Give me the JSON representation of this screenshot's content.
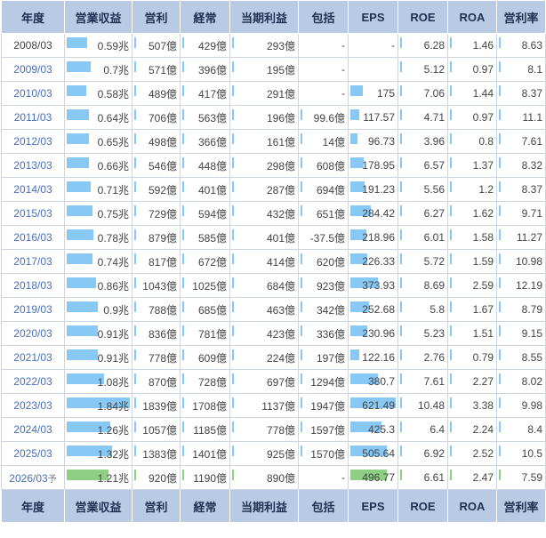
{
  "headers": [
    "年度",
    "営業収益",
    "営利",
    "経常",
    "当期利益",
    "包括",
    "EPS",
    "ROE",
    "ROA",
    "営利率"
  ],
  "estimate_mark": "予",
  "rows": [
    {
      "year": "2008/03",
      "revenue": "0.59兆",
      "rev_val": 0.59,
      "op": "507億",
      "ord": "429億",
      "net": "293億",
      "comp": "-",
      "comp_show": false,
      "eps": "-",
      "eps_val": 0,
      "roe": "6.28",
      "roa": "1.46",
      "margin": "8.63"
    },
    {
      "year": "2009/03",
      "revenue": "0.7兆",
      "rev_val": 0.7,
      "op": "571億",
      "ord": "396億",
      "net": "195億",
      "comp": "-",
      "comp_show": false,
      "eps": "",
      "eps_val": 0,
      "roe": "5.12",
      "roa": "0.97",
      "margin": "8.1"
    },
    {
      "year": "2010/03",
      "revenue": "0.58兆",
      "rev_val": 0.58,
      "op": "489億",
      "ord": "417億",
      "net": "291億",
      "comp": "-",
      "comp_show": false,
      "eps": "175",
      "eps_val": 175,
      "roe": "7.06",
      "roa": "1.44",
      "margin": "8.37"
    },
    {
      "year": "2011/03",
      "revenue": "0.64兆",
      "rev_val": 0.64,
      "op": "706億",
      "ord": "563億",
      "net": "196億",
      "comp": "99.6億",
      "comp_show": true,
      "eps": "117.57",
      "eps_val": 117.57,
      "roe": "4.71",
      "roa": "0.97",
      "margin": "11.1"
    },
    {
      "year": "2012/03",
      "revenue": "0.65兆",
      "rev_val": 0.65,
      "op": "498億",
      "ord": "366億",
      "net": "161億",
      "comp": "14億",
      "comp_show": true,
      "eps": "96.73",
      "eps_val": 96.73,
      "roe": "3.96",
      "roa": "0.8",
      "margin": "7.61"
    },
    {
      "year": "2013/03",
      "revenue": "0.66兆",
      "rev_val": 0.66,
      "op": "546億",
      "ord": "448億",
      "net": "298億",
      "comp": "608億",
      "comp_show": true,
      "eps": "178.95",
      "eps_val": 178.95,
      "roe": "6.57",
      "roa": "1.37",
      "margin": "8.32"
    },
    {
      "year": "2014/03",
      "revenue": "0.71兆",
      "rev_val": 0.71,
      "op": "592億",
      "ord": "401億",
      "net": "287億",
      "comp": "694億",
      "comp_show": true,
      "eps": "191.23",
      "eps_val": 191.23,
      "roe": "5.56",
      "roa": "1.2",
      "margin": "8.37"
    },
    {
      "year": "2015/03",
      "revenue": "0.75兆",
      "rev_val": 0.75,
      "op": "729億",
      "ord": "594億",
      "net": "432億",
      "comp": "651億",
      "comp_show": true,
      "eps": "284.42",
      "eps_val": 284.42,
      "roe": "6.27",
      "roa": "1.62",
      "margin": "9.71"
    },
    {
      "year": "2016/03",
      "revenue": "0.78兆",
      "rev_val": 0.78,
      "op": "879億",
      "ord": "585億",
      "net": "401億",
      "comp": "-37.5億",
      "comp_show": false,
      "eps": "218.96",
      "eps_val": 218.96,
      "roe": "6.01",
      "roa": "1.58",
      "margin": "11.27"
    },
    {
      "year": "2017/03",
      "revenue": "0.74兆",
      "rev_val": 0.74,
      "op": "817億",
      "ord": "672億",
      "net": "414億",
      "comp": "620億",
      "comp_show": true,
      "eps": "226.33",
      "eps_val": 226.33,
      "roe": "5.72",
      "roa": "1.59",
      "margin": "10.98"
    },
    {
      "year": "2018/03",
      "revenue": "0.86兆",
      "rev_val": 0.86,
      "op": "1043億",
      "ord": "1025億",
      "net": "684億",
      "comp": "923億",
      "comp_show": true,
      "eps": "373.93",
      "eps_val": 373.93,
      "roe": "8.69",
      "roa": "2.59",
      "margin": "12.19"
    },
    {
      "year": "2019/03",
      "revenue": "0.9兆",
      "rev_val": 0.9,
      "op": "788億",
      "ord": "685億",
      "net": "463億",
      "comp": "342億",
      "comp_show": true,
      "eps": "252.68",
      "eps_val": 252.68,
      "roe": "5.8",
      "roa": "1.67",
      "margin": "8.79"
    },
    {
      "year": "2020/03",
      "revenue": "0.91兆",
      "rev_val": 0.91,
      "op": "836億",
      "ord": "781億",
      "net": "423億",
      "comp": "336億",
      "comp_show": true,
      "eps": "230.96",
      "eps_val": 230.96,
      "roe": "5.23",
      "roa": "1.51",
      "margin": "9.15"
    },
    {
      "year": "2021/03",
      "revenue": "0.91兆",
      "rev_val": 0.91,
      "op": "778億",
      "ord": "609億",
      "net": "224億",
      "comp": "197億",
      "comp_show": true,
      "eps": "122.16",
      "eps_val": 122.16,
      "roe": "2.76",
      "roa": "0.79",
      "margin": "8.55"
    },
    {
      "year": "2022/03",
      "revenue": "1.08兆",
      "rev_val": 1.08,
      "op": "870億",
      "ord": "728億",
      "net": "697億",
      "comp": "1294億",
      "comp_show": true,
      "eps": "380.7",
      "eps_val": 380.7,
      "roe": "7.61",
      "roa": "2.27",
      "margin": "8.02"
    },
    {
      "year": "2023/03",
      "revenue": "1.84兆",
      "rev_val": 1.84,
      "op": "1839億",
      "ord": "1708億",
      "net": "1137億",
      "comp": "1947億",
      "comp_show": true,
      "eps": "621.49",
      "eps_val": 621.49,
      "roe": "10.48",
      "roa": "3.38",
      "margin": "9.98"
    },
    {
      "year": "2024/03",
      "revenue": "1.26兆",
      "rev_val": 1.26,
      "op": "1057億",
      "ord": "1185億",
      "net": "778億",
      "comp": "1597億",
      "comp_show": true,
      "eps": "425.3",
      "eps_val": 425.3,
      "roe": "6.4",
      "roa": "2.24",
      "margin": "8.4"
    },
    {
      "year": "2025/03",
      "revenue": "1.32兆",
      "rev_val": 1.32,
      "op": "1383億",
      "ord": "1401億",
      "net": "925億",
      "comp": "1570億",
      "comp_show": true,
      "eps": "505.64",
      "eps_val": 505.64,
      "roe": "6.92",
      "roa": "2.52",
      "margin": "10.5"
    },
    {
      "year": "2026/03",
      "revenue": "1.21兆",
      "rev_val": 1.21,
      "op": "920億",
      "ord": "1190億",
      "net": "890億",
      "comp": "-",
      "comp_show": false,
      "eps": "496.77",
      "eps_val": 496.77,
      "roe": "6.61",
      "roa": "2.47",
      "margin": "7.59",
      "estimate": true
    }
  ],
  "colors": {
    "header_bg": "#b9cbe4",
    "bar": "#87c8f5",
    "bar_estimate": "#8fcf84",
    "year_link": "#4b6fb3"
  }
}
